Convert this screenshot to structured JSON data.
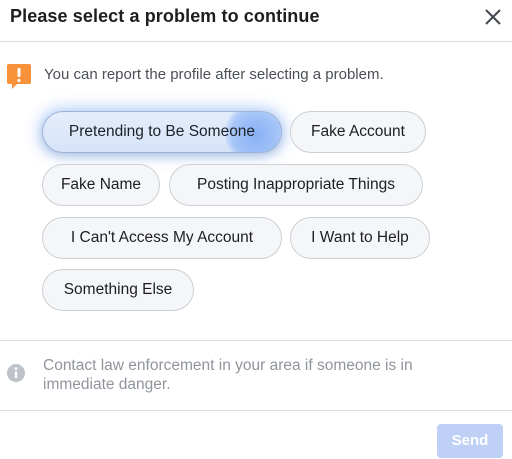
{
  "dialog": {
    "title": "Please select a problem to continue",
    "close_icon": "close-icon"
  },
  "notice": {
    "icon": "warning-flag-icon",
    "accent_color": "#f7923b",
    "text": "You can report the profile after selecting a problem."
  },
  "problems": {
    "selected": "Pretending to Be Someone",
    "options": [
      "Pretending to Be Someone",
      "Fake Account",
      "Fake Name",
      "Posting Inappropriate Things",
      "I Can't Access My Account",
      "I Want to Help",
      "Something Else"
    ]
  },
  "info": {
    "icon": "info-icon",
    "text": "Contact law enforcement in your area if someone is in immediate danger."
  },
  "footer": {
    "send_label": "Send",
    "send_color": "#bed0f5"
  }
}
